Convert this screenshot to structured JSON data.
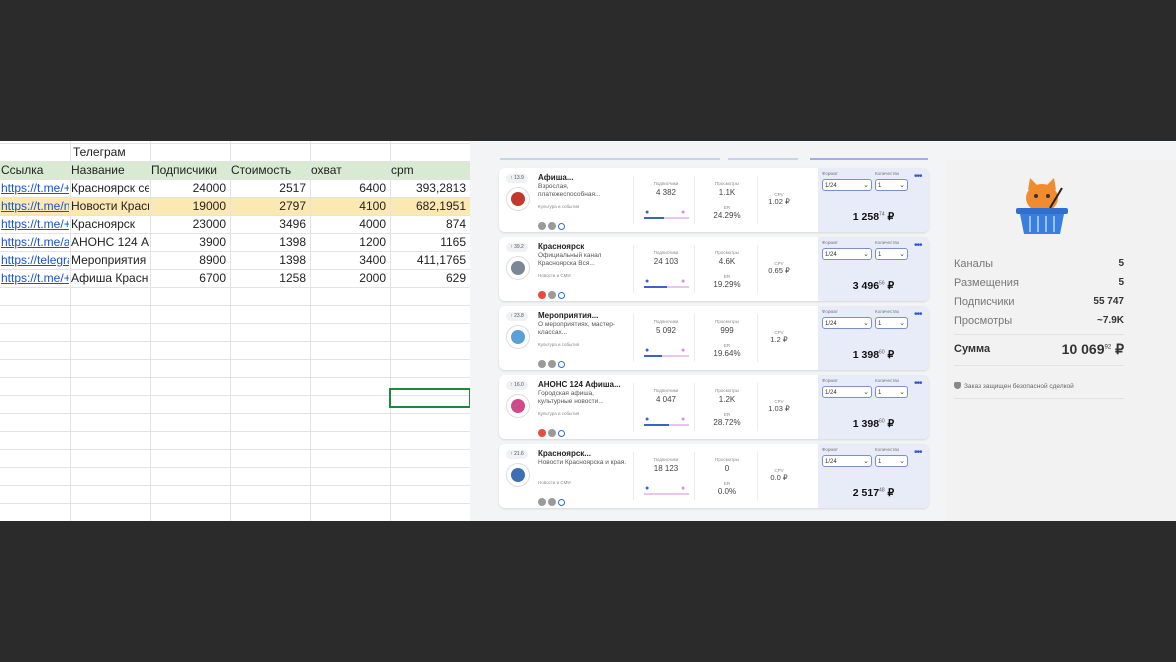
{
  "sheet": {
    "group_label": "Телеграм",
    "headers": [
      "Ссылка",
      "Название",
      "Подписчики",
      "Стоимость",
      "охват",
      "cpm"
    ],
    "rows": [
      [
        "https://t.me/+Hl9",
        "Красноярск се",
        "24000",
        "2517",
        "6400",
        "393,2813"
      ],
      [
        "https://t.me/nov",
        "Новости Красн",
        "19000",
        "2797",
        "4100",
        "682,1951"
      ],
      [
        "https://t.me/+O",
        "Красноярск",
        "23000",
        "3496",
        "4000",
        "874"
      ],
      [
        "https://t.me/anc",
        "АНОНС 124 А",
        "3900",
        "1398",
        "1200",
        "1165"
      ],
      [
        "https://telegram",
        "Мероприятия",
        "8900",
        "1398",
        "3400",
        "411,1765"
      ],
      [
        "https://t.me/+bl",
        "Афиша Красн",
        "6700",
        "1258",
        "2000",
        "629"
      ]
    ]
  },
  "cards": [
    {
      "rank": "13.9",
      "title": "Афиша...",
      "desc": "Взрослая, платежеспособная...",
      "category": "Культура и события",
      "chips": [
        "grey",
        "grey",
        "blue"
      ],
      "subs_label": "Подписчики",
      "subs": "4 382",
      "views_label": "Просмотры",
      "views": "1.1K",
      "er_label": "ER",
      "er": "24.29%",
      "cpv_label": "CPV",
      "cpv": "1.02 ₽",
      "format_label": "Формат",
      "qty_label": "Количество",
      "format": "1/24",
      "qty": "1",
      "price_main": "1 258",
      "price_kop": "74",
      "currency": "₽",
      "fill": 0.45,
      "avatar_color": "#c0392b"
    },
    {
      "rank": "39.2",
      "title": "Красноярск",
      "desc": "Официальный канал Красноярска Вся...",
      "category": "Новости и СМИ",
      "chips": [
        "red",
        "grey",
        "blue"
      ],
      "subs_label": "Подписчики",
      "subs": "24 103",
      "views_label": "Просмотры",
      "views": "4.6K",
      "er_label": "ER",
      "er": "19.29%",
      "cpv_label": "CPV",
      "cpv": "0.65 ₽",
      "format_label": "Формат",
      "qty_label": "Количество",
      "format": "1/24",
      "qty": "1",
      "price_main": "3 496",
      "price_kop": "56",
      "currency": "₽",
      "fill": 0.5,
      "avatar_color": "#7a8794"
    },
    {
      "rank": "23.8",
      "title": "Мероприятия...",
      "desc": "О мероприятиях, мастер-классах...",
      "category": "Культура и события",
      "chips": [
        "grey",
        "grey",
        "blue"
      ],
      "subs_label": "Подписчики",
      "subs": "5 092",
      "views_label": "Просмотры",
      "views": "999",
      "er_label": "ER",
      "er": "19.64%",
      "cpv_label": "CPV",
      "cpv": "1.2 ₽",
      "format_label": "Формат",
      "qty_label": "Количество",
      "format": "1/24",
      "qty": "1",
      "price_main": "1 398",
      "price_kop": "60",
      "currency": "₽",
      "fill": 0.4,
      "avatar_color": "#5aa0d8"
    },
    {
      "rank": "16.0",
      "title": "АНОНС 124 Афиша...",
      "desc": "Городская афиша, культурные новости...",
      "category": "Культура и события",
      "chips": [
        "red",
        "grey",
        "blue"
      ],
      "subs_label": "Подписчики",
      "subs": "4 047",
      "views_label": "Просмотры",
      "views": "1.2K",
      "er_label": "ER",
      "er": "28.72%",
      "cpv_label": "CPV",
      "cpv": "1.03 ₽",
      "format_label": "Формат",
      "qty_label": "Количество",
      "format": "1/24",
      "qty": "1",
      "price_main": "1 398",
      "price_kop": "60",
      "currency": "₽",
      "fill": 0.55,
      "avatar_color": "#d04a8a"
    },
    {
      "rank": "21.6",
      "title": "Красноярск...",
      "desc": "Новости Красноярска и края.",
      "category": "Новости и СМИ",
      "chips": [
        "grey",
        "grey",
        "blue"
      ],
      "subs_label": "Подписчики",
      "subs": "18 123",
      "views_label": "Просмотры",
      "views": "0",
      "er_label": "ER",
      "er": "0.0%",
      "cpv_label": "CPV",
      "cpv": "0.0 ₽",
      "format_label": "Формат",
      "qty_label": "Количество",
      "format": "1/24",
      "qty": "1",
      "price_main": "2 517",
      "price_kop": "48",
      "currency": "₽",
      "fill": 0.0,
      "avatar_color": "#3d6fb6"
    }
  ],
  "summary": {
    "channels_label": "Каналы",
    "channels": "5",
    "placements_label": "Размещения",
    "placements": "5",
    "subscribers_label": "Подписчики",
    "subscribers": "55 747",
    "views_label": "Просмотры",
    "views": "~7.9K",
    "total_label": "Сумма",
    "total_main": "10 069",
    "total_kop": "92",
    "currency": "₽",
    "safe_deal": "Заказ защищен безопасной сделкой"
  },
  "icons": [
    "basket-cat-icon",
    "shield-icon",
    "person-icon",
    "more-dots-icon",
    "chevron-down-icon"
  ]
}
